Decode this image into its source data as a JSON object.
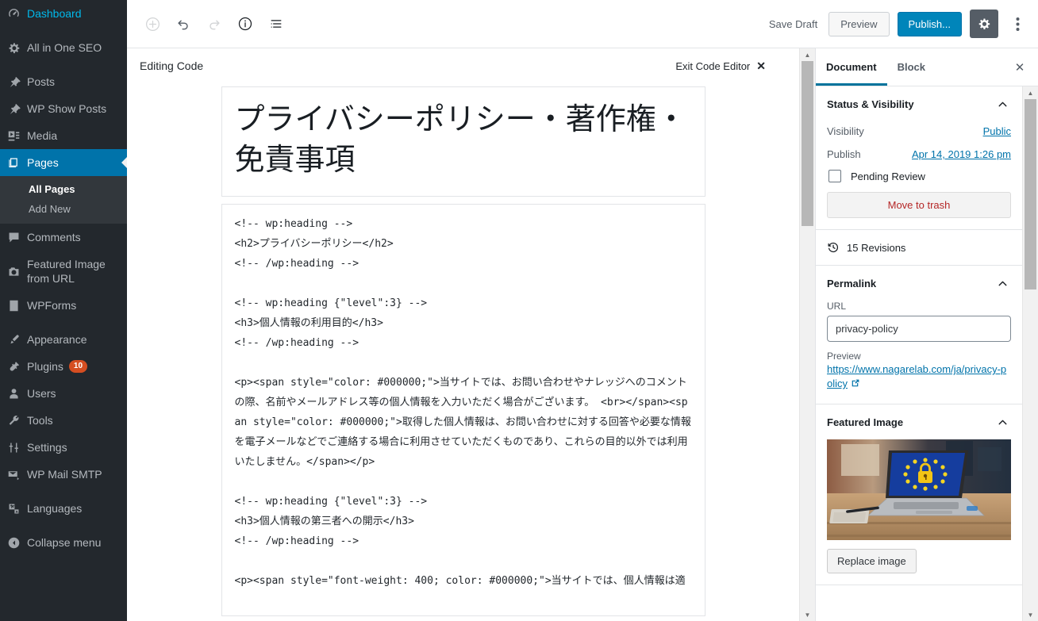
{
  "admin_menu": {
    "items": [
      {
        "label": "Dashboard",
        "icon": "dashboard-icon",
        "name": "sidebar-item-dashboard",
        "sep_after": true
      },
      {
        "label": "All in One SEO",
        "icon": "gear-icon",
        "name": "sidebar-item-all-in-one-seo",
        "sep_after": true
      },
      {
        "label": "Posts",
        "icon": "pin-icon",
        "name": "sidebar-item-posts"
      },
      {
        "label": "WP Show Posts",
        "icon": "pin-icon",
        "name": "sidebar-item-wp-show-posts"
      },
      {
        "label": "Media",
        "icon": "media-icon",
        "name": "sidebar-item-media"
      },
      {
        "label": "Pages",
        "icon": "pages-icon",
        "name": "sidebar-item-pages",
        "current": true
      },
      {
        "label": "Comments",
        "icon": "comment-icon",
        "name": "sidebar-item-comments"
      },
      {
        "label": "Featured Image from URL",
        "icon": "camera-icon",
        "name": "sidebar-item-featured-image-from-url"
      },
      {
        "label": "WPForms",
        "icon": "form-icon",
        "name": "sidebar-item-wpforms",
        "sep_after": true
      },
      {
        "label": "Appearance",
        "icon": "brush-icon",
        "name": "sidebar-item-appearance"
      },
      {
        "label": "Plugins",
        "icon": "plug-icon",
        "name": "sidebar-item-plugins",
        "badge": "10"
      },
      {
        "label": "Users",
        "icon": "user-icon",
        "name": "sidebar-item-users"
      },
      {
        "label": "Tools",
        "icon": "wrench-icon",
        "name": "sidebar-item-tools"
      },
      {
        "label": "Settings",
        "icon": "sliders-icon",
        "name": "sidebar-item-settings"
      },
      {
        "label": "WP Mail SMTP",
        "icon": "mail-icon",
        "name": "sidebar-item-wp-mail-smtp",
        "sep_after": true
      },
      {
        "label": "Languages",
        "icon": "translate-icon",
        "name": "sidebar-item-languages"
      }
    ],
    "submenu": [
      {
        "label": "All Pages",
        "current": true
      },
      {
        "label": "Add New",
        "current": false
      }
    ],
    "collapse": "Collapse menu"
  },
  "header": {
    "add_block_title": "Add block",
    "undo_title": "Undo",
    "redo_title": "Redo",
    "info_title": "Content structure",
    "block_nav_title": "Block navigation",
    "save_draft": "Save Draft",
    "preview": "Preview",
    "publish": "Publish...",
    "settings_title": "Settings",
    "more_title": "More tools & options"
  },
  "code_editor": {
    "title": "Editing Code",
    "exit_label": "Exit Code Editor",
    "exit_x": "✕",
    "post_title": "プライバシーポリシー・著作権・免責事項",
    "content": "<!-- wp:heading -->\n<h2>プライバシーポリシー</h2>\n<!-- /wp:heading -->\n\n<!-- wp:heading {\"level\":3} -->\n<h3>個人情報の利用目的</h3>\n<!-- /wp:heading -->\n\n<p><span style=\"color: #000000;\">当サイトでは、お問い合わせやナレッジへのコメントの際、名前やメールアドレス等の個人情報を入力いただく場合がございます。 <br></span><span style=\"color: #000000;\">取得した個人情報は、お問い合わせに対する回答や必要な情報を電子メールなどでご連絡する場合に利用させていただくものであり、これらの目的以外では利用いたしません。</span></p>\n\n<!-- wp:heading {\"level\":3} -->\n<h3>個人情報の第三者への開示</h3>\n<!-- /wp:heading -->\n\n<p><span style=\"font-weight: 400; color: #000000;\">当サイトでは、個人情報は適"
  },
  "settings": {
    "tabs": [
      {
        "label": "Document",
        "active": true,
        "name": "tab-document"
      },
      {
        "label": "Block",
        "active": false,
        "name": "tab-block"
      }
    ],
    "close_label": "✕",
    "status_visibility": {
      "title": "Status & Visibility",
      "visibility_label": "Visibility",
      "visibility_value": "Public",
      "publish_label": "Publish",
      "publish_value": "Apr 14, 2019 1:26 pm",
      "pending_review_label": "Pending Review",
      "pending_review_checked": false,
      "move_to_trash": "Move to trash"
    },
    "revisions": {
      "label": "15 Revisions"
    },
    "permalink": {
      "title": "Permalink",
      "url_label": "URL",
      "url_value": "privacy-policy",
      "preview_label": "Preview",
      "preview_url": "https://www.nagarelab.com/ja/privacy-policy"
    },
    "featured_image": {
      "title": "Featured Image",
      "replace_label": "Replace image",
      "alt": "laptop-eu-flag-padlock"
    }
  },
  "colors": {
    "admin_bg": "#23282d",
    "submenu_bg": "#32373c",
    "accent_blue": "#0073aa",
    "publish_blue": "#0085ba",
    "link_blue": "#0073aa",
    "badge_orange": "#d54e21",
    "trash_red": "#b52727"
  }
}
